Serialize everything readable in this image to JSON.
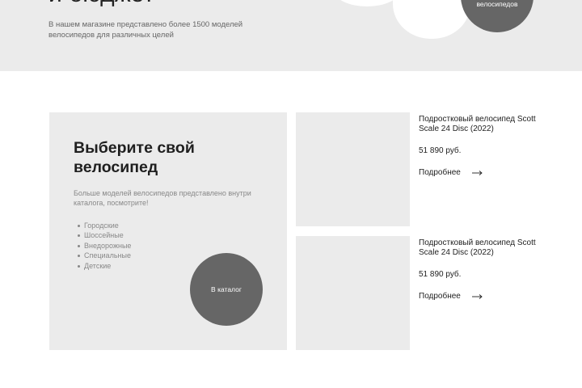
{
  "hero": {
    "title": "и бюджет",
    "description": "В нашем магазине представлено более 1500 моделей велосипедов для различных целей",
    "circle_label": "велосипедов"
  },
  "catalog": {
    "title": "Выберите свой велосипед",
    "description": "Больше моделей велосипедов представлено внутри каталога, посмотрите!",
    "categories": [
      "Городские",
      "Шоссейные",
      "Внедорожные",
      "Специальные",
      "Детские"
    ],
    "button_label": "В каталог"
  },
  "products": [
    {
      "name": "Подростковый велосипед Scott Scale 24 Disc (2022)",
      "price": "51 890 руб.",
      "more_label": "Подробнее",
      "arrow_icon": "arrow-right-icon"
    },
    {
      "name": "Подростковый велосипед Scott Scale 24 Disc (2022)",
      "price": "51 890 руб.",
      "more_label": "Подробнее",
      "arrow_icon": "arrow-right-icon"
    }
  ],
  "colors": {
    "panel_bg": "#ebebeb",
    "button_bg": "#666666",
    "text_dark": "#1f1f1f",
    "text_muted": "#888888"
  }
}
